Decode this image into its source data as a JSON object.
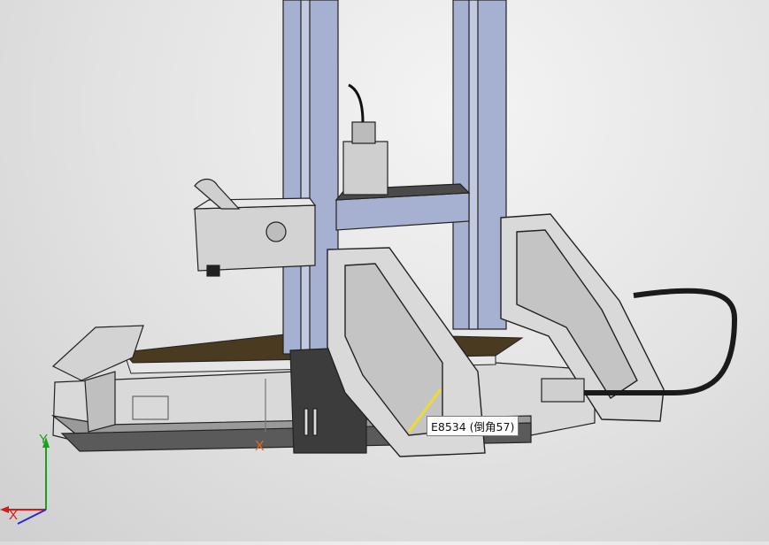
{
  "viewport": {
    "model": "3D printer assembly",
    "tooltip": "E8534 (倒角57)",
    "axes": {
      "y": "Y",
      "x": "X"
    },
    "origin_label": "X"
  },
  "colors": {
    "frame": "#a6b0d0",
    "frame_dark": "#7e88aa",
    "body": "#d9d9d9",
    "body_dark": "#8c8c8c",
    "bed": "#4a3a1f",
    "highlight": "#f0dc30",
    "cable": "#1a1a1a",
    "axis_y": "#1aa01a",
    "axis_x": "#d21a1a"
  }
}
